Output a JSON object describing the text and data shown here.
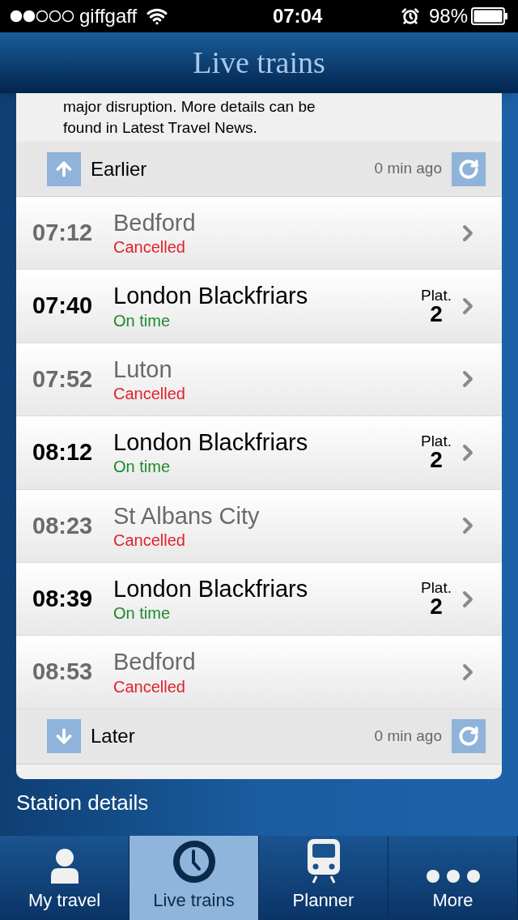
{
  "status_bar": {
    "carrier": "giffgaff",
    "time": "07:04",
    "battery": "98%"
  },
  "header": {
    "title": "Live trains"
  },
  "notice": {
    "lines": [
      "major disruption. More details can be",
      "found in Latest Travel News."
    ]
  },
  "earlier": {
    "label": "Earlier",
    "updated": "0 min ago"
  },
  "services": [
    {
      "time": "07:12",
      "destination": "Bedford",
      "status": "Cancelled",
      "kind": "cancelled"
    },
    {
      "time": "07:40",
      "destination": "London Blackfriars",
      "status": "On time",
      "kind": "on_time",
      "platform_label": "Plat.",
      "platform": "2"
    },
    {
      "time": "07:52",
      "destination": "Luton",
      "status": "Cancelled",
      "kind": "cancelled"
    },
    {
      "time": "08:12",
      "destination": "London Blackfriars",
      "status": "On time",
      "kind": "on_time",
      "platform_label": "Plat.",
      "platform": "2"
    },
    {
      "time": "08:23",
      "destination": "St Albans City",
      "status": "Cancelled",
      "kind": "cancelled"
    },
    {
      "time": "08:39",
      "destination": "London Blackfriars",
      "status": "On time",
      "kind": "on_time",
      "platform_label": "Plat.",
      "platform": "2"
    },
    {
      "time": "08:53",
      "destination": "Bedford",
      "status": "Cancelled",
      "kind": "cancelled"
    }
  ],
  "later": {
    "label": "Later",
    "updated": "0 min ago"
  },
  "section_heading": "Station details",
  "tabs": [
    {
      "label": "My travel",
      "kind": "person",
      "selected": false
    },
    {
      "label": "Live trains",
      "kind": "clock",
      "selected": true
    },
    {
      "label": "Planner",
      "kind": "train",
      "selected": false
    },
    {
      "label": "More",
      "kind": "dots",
      "selected": false
    }
  ]
}
